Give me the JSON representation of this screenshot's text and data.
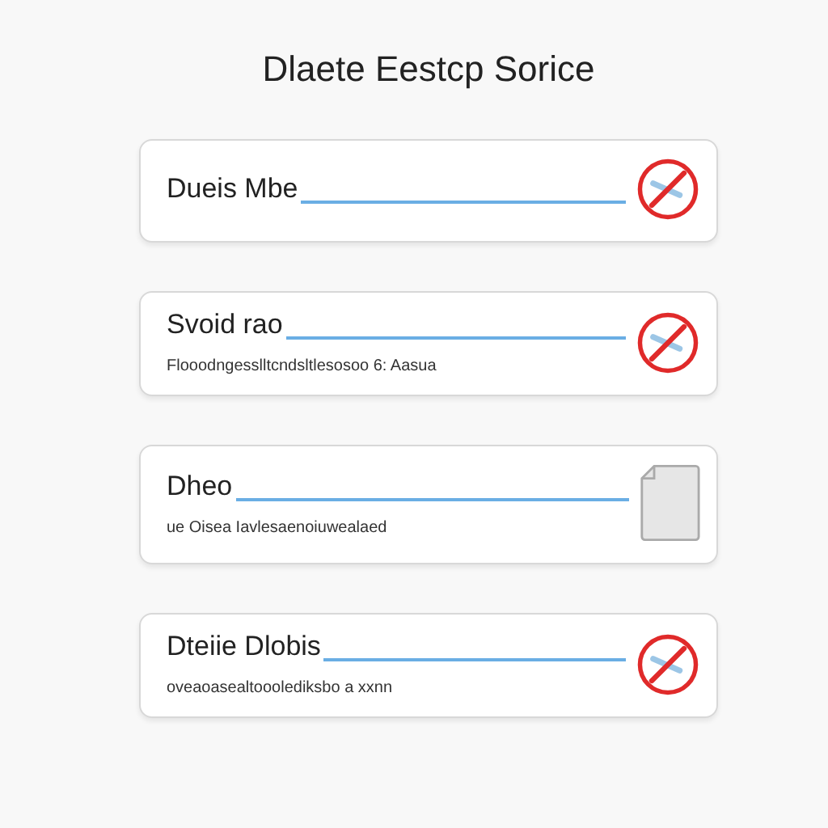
{
  "title": "Dlaete Eestcp Sorice",
  "items": [
    {
      "name": "Dueis Mbe",
      "kind": "blocked"
    },
    {
      "name": "Svoid rao",
      "description": "Flooodngesslltcndsltlesosoo 6: Aasua",
      "kind": "blocked"
    },
    {
      "name": "Dheo",
      "description": "ue Oisea Iavlesaenoiuwealaed",
      "kind": "file"
    },
    {
      "name": "Dteiie Dlobis",
      "description": "oveaoasealtooolediksbo a xxnn",
      "kind": "blocked"
    }
  ]
}
